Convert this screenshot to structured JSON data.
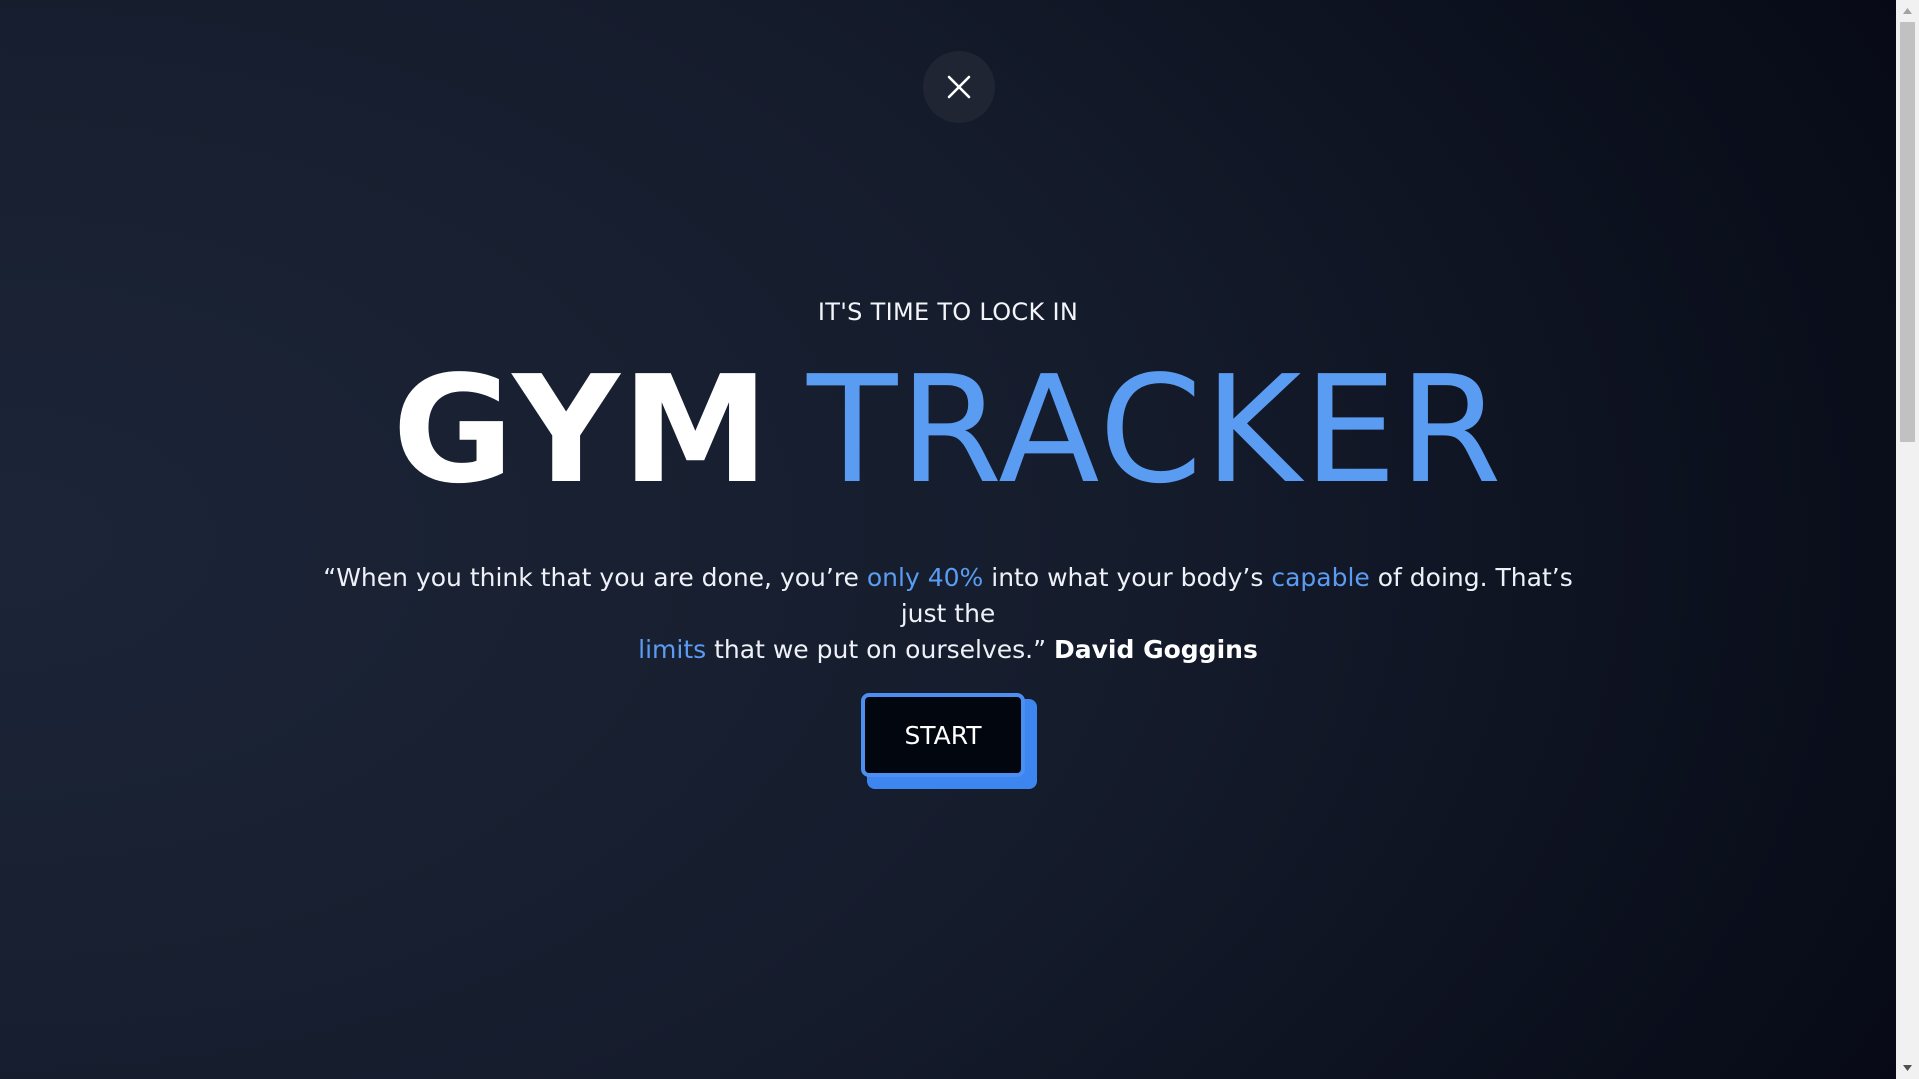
{
  "close_button": {
    "icon": "close-icon",
    "label": ""
  },
  "hero": {
    "eyebrow": "IT'S TIME TO LOCK IN",
    "title_part1": "GYM",
    "title_part2": "TRACKER",
    "quote": {
      "segment1": "“When you think that you are done, you’re ",
      "highlight1": "only 40%",
      "segment2": " into what your body’s ",
      "highlight2": "capable",
      "segment3": " of doing. That’s just the ",
      "highlight3": "limits",
      "segment4": " that we put on ourselves.” ",
      "author": "David Goggins"
    },
    "start_label": "START"
  },
  "colors": {
    "accent": "#5b9cf3",
    "background_dark": "#03050e",
    "background_light": "#1c2538",
    "button_bg": "#02060f"
  },
  "scrollbar": {
    "up_icon": "arrow-up-icon",
    "down_icon": "arrow-down-icon"
  }
}
